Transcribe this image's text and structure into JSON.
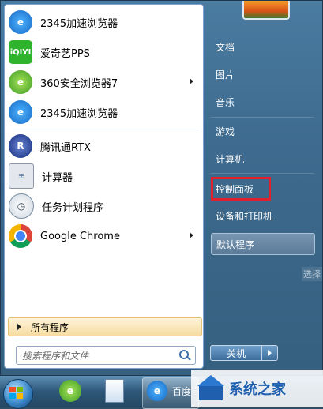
{
  "left_programs": [
    {
      "label": "2345加速浏览器",
      "icon": "ie-browser-icon",
      "has_submenu": false
    },
    {
      "label": "爱奇艺PPS",
      "icon": "iqiyi-icon",
      "has_submenu": false
    },
    {
      "label": "360安全浏览器7",
      "icon": "360-browser-icon",
      "has_submenu": true
    },
    {
      "label": "2345加速浏览器",
      "icon": "ie-browser-icon",
      "has_submenu": false
    },
    {
      "label": "腾讯通RTX",
      "icon": "rtx-icon",
      "has_submenu": false
    },
    {
      "label": "计算器",
      "icon": "calculator-icon",
      "has_submenu": false
    },
    {
      "label": "任务计划程序",
      "icon": "clock-icon",
      "has_submenu": false
    },
    {
      "label": "Google Chrome",
      "icon": "chrome-icon",
      "has_submenu": true
    }
  ],
  "all_programs_label": "所有程序",
  "search_placeholder": "搜索程序和文件",
  "right_items": [
    {
      "label": "文档"
    },
    {
      "label": "图片"
    },
    {
      "label": "音乐"
    },
    {
      "label": "游戏"
    },
    {
      "label": "计算机"
    },
    {
      "label": "控制面板",
      "highlighted": true
    },
    {
      "label": "设备和打印机"
    },
    {
      "label": "默认程序",
      "hovered": true
    }
  ],
  "shutdown_label": "关机",
  "ghost_tooltip": "选择",
  "taskbar": {
    "partial_label": "百度"
  },
  "watermark": {
    "text": "系统之家"
  },
  "colors": {
    "highlight_border": "#e0202a",
    "menu_blue": "#3d6a8e"
  }
}
